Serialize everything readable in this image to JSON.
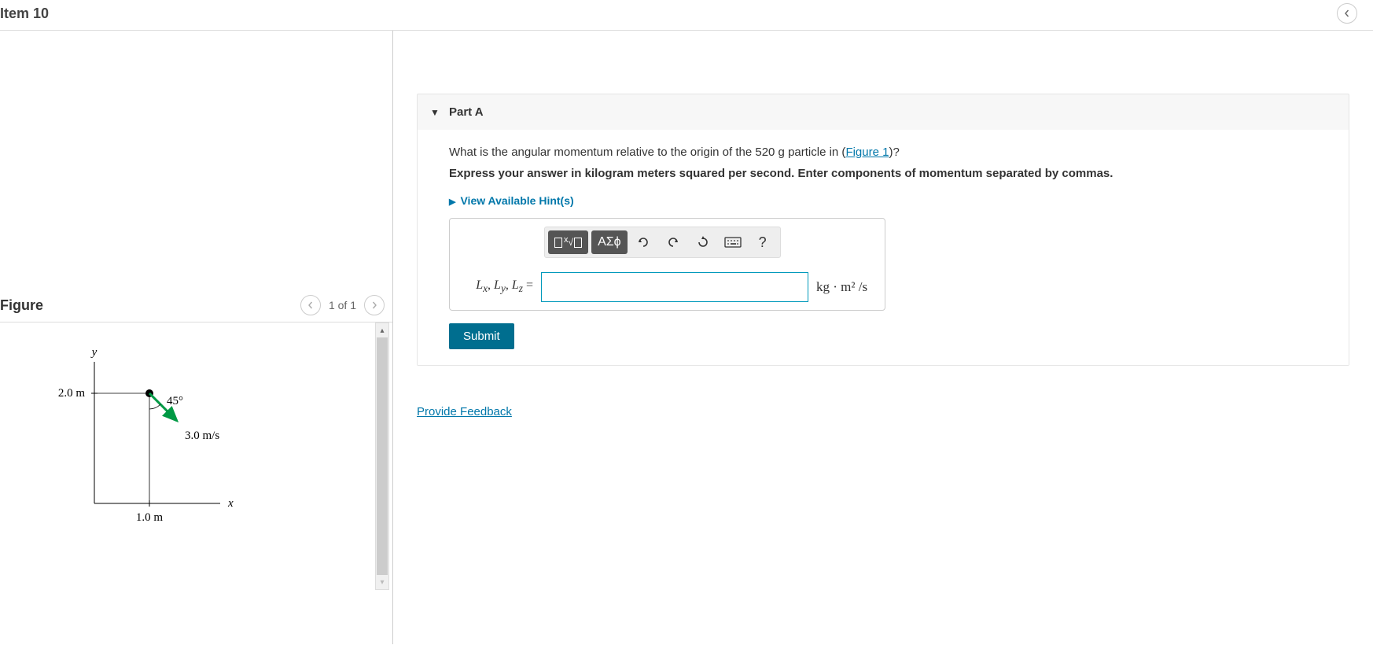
{
  "header": {
    "item_title": "Item 10"
  },
  "figure": {
    "panel_title": "Figure",
    "pager": "1 of 1",
    "labels": {
      "y_axis": "y",
      "x_axis": "x",
      "y_value": "2.0 m",
      "x_value": "1.0 m",
      "angle": "45°",
      "velocity": "3.0 m/s"
    }
  },
  "part": {
    "title": "Part A",
    "question_prefix": "What is the angular momentum relative to the origin of the 520 g particle in (",
    "figure_link_text": "Figure 1",
    "question_suffix": ")?",
    "instruction": "Express your answer in kilogram meters squared per second. Enter components of momentum separated by commas.",
    "hints_label": "View Available Hint(s)",
    "toolbar": {
      "templates": "▭√▭",
      "greek": "ΑΣϕ",
      "undo": "↶",
      "redo": "↷",
      "reset": "↻",
      "keyboard": "⌨",
      "help": "?"
    },
    "answer": {
      "label_html": "Lx, Ly, Lz =",
      "units": "kg · m² /s"
    },
    "submit_label": "Submit",
    "feedback_label": "Provide Feedback"
  }
}
